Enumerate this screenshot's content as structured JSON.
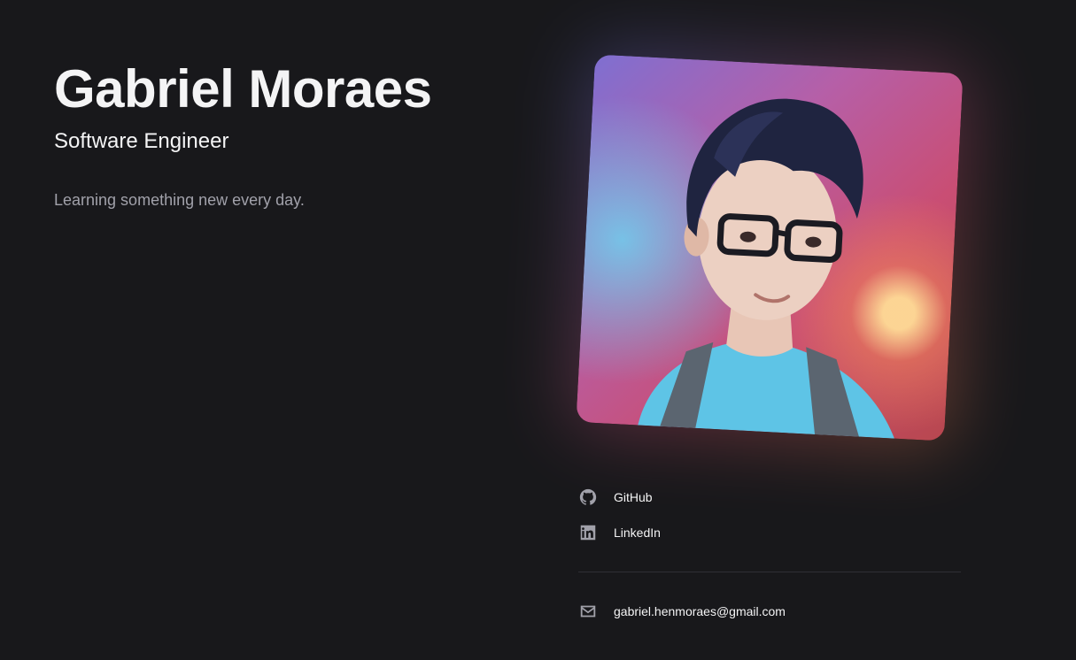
{
  "profile": {
    "name": "Gabriel Moraes",
    "role": "Software Engineer",
    "tagline": "Learning something new every day."
  },
  "links": {
    "github": {
      "label": "GitHub",
      "icon": "github-icon"
    },
    "linkedin": {
      "label": "LinkedIn",
      "icon": "linkedin-icon"
    }
  },
  "contact": {
    "email": "gabriel.henmoraes@gmail.com",
    "icon": "mail-icon"
  },
  "colors": {
    "background": "#18181b",
    "text": "#f4f4f5",
    "muted": "#a1a1aa"
  }
}
